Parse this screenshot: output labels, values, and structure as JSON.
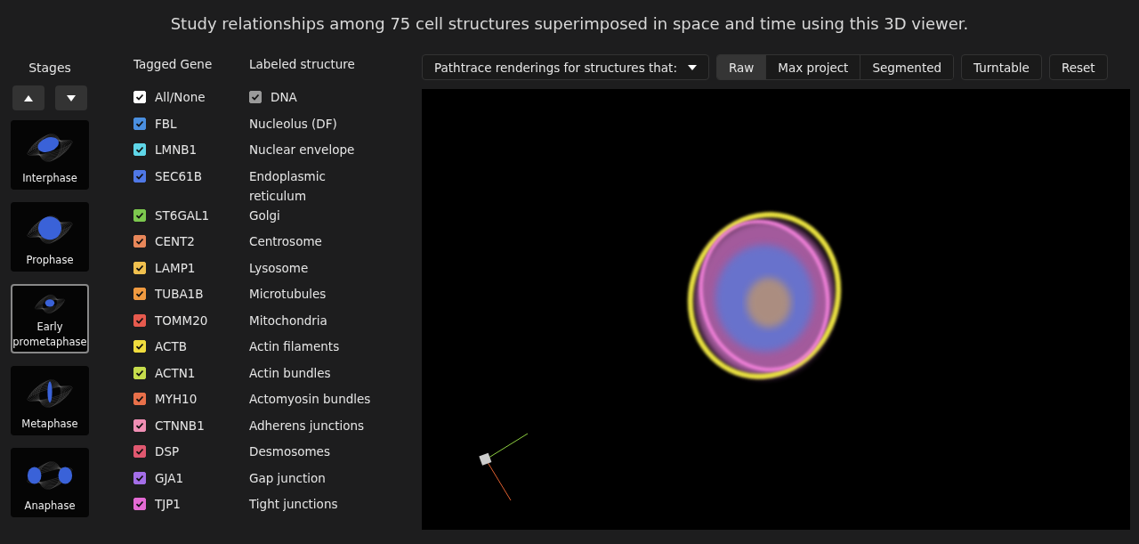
{
  "header": {
    "text": "Study relationships among 75 cell structures superimposed in space and time using this 3D viewer."
  },
  "stages": {
    "title": "Stages",
    "items": [
      {
        "label": "Interphase",
        "selected": false
      },
      {
        "label": "Prophase",
        "selected": false
      },
      {
        "label": "Early prometaphase",
        "selected": true
      },
      {
        "label": "Metaphase",
        "selected": false
      },
      {
        "label": "Anaphase",
        "selected": false
      }
    ]
  },
  "legend": {
    "gene_heading": "Tagged Gene",
    "structure_heading": "Labeled structure",
    "all_none": {
      "label": "All/None",
      "checked": true
    },
    "dna": {
      "label": "DNA",
      "checked": true
    },
    "rows": [
      {
        "gene": "FBL",
        "structure": "Nucleolus (DF)",
        "color": "#4a8fe0",
        "checked": true
      },
      {
        "gene": "LMNB1",
        "structure": "Nuclear envelope",
        "color": "#5fd6e8",
        "checked": true
      },
      {
        "gene": "SEC61B",
        "structure": "Endoplasmic reticulum",
        "color": "#4f78e6",
        "checked": true
      },
      {
        "gene": "ST6GAL1",
        "structure": "Golgi",
        "color": "#7cc84e",
        "checked": true
      },
      {
        "gene": "CENT2",
        "structure": "Centrosome",
        "color": "#e8875a",
        "checked": true
      },
      {
        "gene": "LAMP1",
        "structure": "Lysosome",
        "color": "#f0c04e",
        "checked": true
      },
      {
        "gene": "TUBA1B",
        "structure": "Microtubules",
        "color": "#f09a40",
        "checked": true
      },
      {
        "gene": "TOMM20",
        "structure": "Mitochondria",
        "color": "#e65a4e",
        "checked": true
      },
      {
        "gene": "ACTB",
        "structure": "Actin filaments",
        "color": "#f0dc3e",
        "checked": true
      },
      {
        "gene": "ACTN1",
        "structure": "Actin bundles",
        "color": "#c6dc4c",
        "checked": true
      },
      {
        "gene": "MYH10",
        "structure": "Actomyosin bundles",
        "color": "#e8704a",
        "checked": true
      },
      {
        "gene": "CTNNB1",
        "structure": "Adherens junctions",
        "color": "#f08eb4",
        "checked": true
      },
      {
        "gene": "DSP",
        "structure": "Desmosomes",
        "color": "#e05870",
        "checked": true
      },
      {
        "gene": "GJA1",
        "structure": "Gap junction",
        "color": "#a46ee8",
        "checked": true
      },
      {
        "gene": "TJP1",
        "structure": "Tight junctions",
        "color": "#e46ad4",
        "checked": true
      }
    ]
  },
  "toolbar": {
    "dropdown": "Pathtrace renderings for structures that:",
    "modes": [
      {
        "label": "Raw",
        "selected": true
      },
      {
        "label": "Max project",
        "selected": false
      },
      {
        "label": "Segmented",
        "selected": false
      }
    ],
    "turntable": "Turntable",
    "reset": "Reset"
  }
}
